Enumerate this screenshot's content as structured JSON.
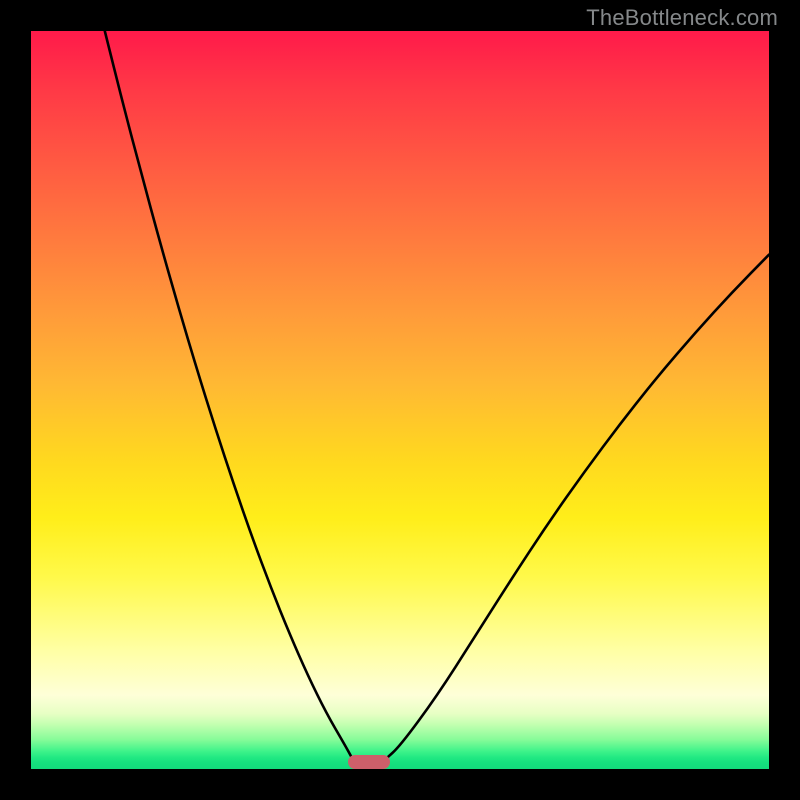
{
  "watermark": "TheBottleneck.com",
  "colors": {
    "page_bg": "#000000",
    "curve": "#000000",
    "marker": "#cd5f6a",
    "watermark_text": "#85888a",
    "gradient_stops": [
      "#ff1a4a",
      "#ff3946",
      "#ff5a42",
      "#ff7a3e",
      "#ff9a3a",
      "#ffb933",
      "#ffd81f",
      "#ffee1a",
      "#fff94a",
      "#ffffa5",
      "#feffd8",
      "#e7ffc4",
      "#c2ffb0",
      "#87fc99",
      "#3ef38a",
      "#20e882",
      "#15e07e",
      "#13db7c"
    ]
  },
  "chart_data": {
    "type": "line",
    "title": "",
    "xlabel": "",
    "ylabel": "",
    "xlim": [
      0,
      100
    ],
    "ylim": [
      0,
      100
    ],
    "legend": false,
    "grid": false,
    "series": [
      {
        "name": "left-branch",
        "x": [
          10.0,
          12.5,
          15.0,
          17.5,
          20.0,
          22.5,
          25.0,
          27.5,
          30.0,
          32.5,
          35.0,
          37.5,
          40.0,
          42.5,
          43.6
        ],
        "y": [
          100.0,
          90.0,
          80.5,
          71.3,
          62.5,
          54.1,
          46.1,
          38.5,
          31.3,
          24.6,
          18.4,
          12.7,
          7.6,
          3.3,
          1.3
        ]
      },
      {
        "name": "right-branch",
        "x": [
          48.0,
          50.0,
          55.0,
          60.0,
          65.0,
          70.0,
          75.0,
          80.0,
          85.0,
          90.0,
          95.0,
          100.0
        ],
        "y": [
          1.3,
          3.1,
          9.9,
          17.7,
          25.6,
          33.2,
          40.3,
          47.0,
          53.3,
          59.1,
          64.6,
          69.7
        ]
      }
    ],
    "annotations": [
      {
        "name": "bottom-marker",
        "shape": "rounded-rect",
        "x_center": 45.8,
        "y_center": 1.0,
        "width": 5.8,
        "height": 1.9,
        "color": "#cd5f6a"
      }
    ]
  }
}
